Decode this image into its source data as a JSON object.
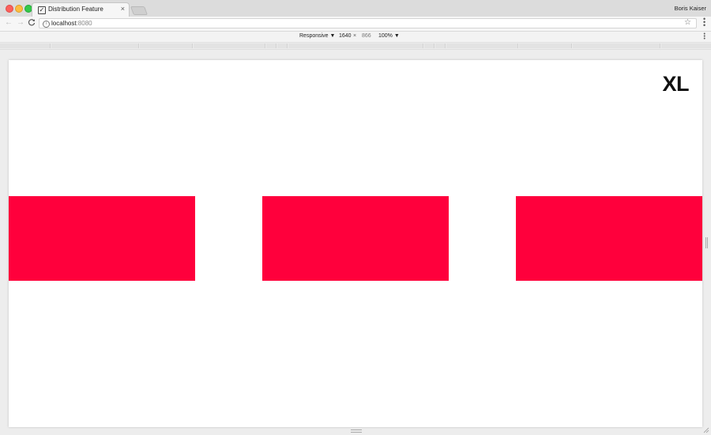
{
  "window": {
    "tab": {
      "title": "Distribution Feature",
      "favicon": "checkbox-favicon",
      "close_symbol": "×"
    },
    "profile_name": "Boris Kaiser"
  },
  "toolbar": {
    "back_symbol": "←",
    "forward_symbol": "→",
    "reload_symbol": "C",
    "url_host": "localhost",
    "url_port": ":8080",
    "info_symbol": "i",
    "star_symbol": "☆",
    "menu_symbol": "⋮"
  },
  "device_toolbar": {
    "device": "Responsive ▼",
    "width": "1640",
    "times": "×",
    "height": "866",
    "zoom": "100% ▼",
    "menu_symbol": "⋮"
  },
  "page": {
    "breakpoint_label": "XL",
    "box_color": "#ff003c",
    "box_count": 3
  }
}
